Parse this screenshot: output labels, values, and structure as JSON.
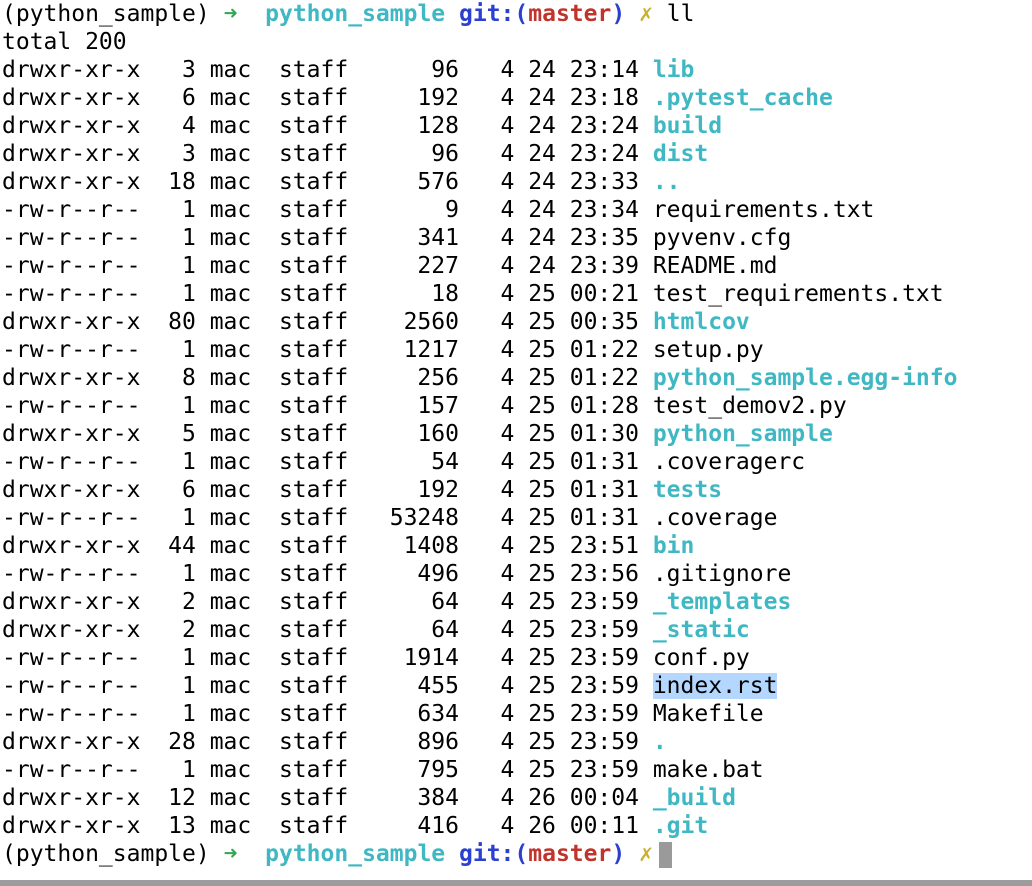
{
  "prompt": {
    "cwd": "(python_sample)",
    "arrow": "➜",
    "repo": "python_sample",
    "git_open": "git:(",
    "branch": "master",
    "git_close": ")",
    "dirty": "✗"
  },
  "command": "ll",
  "total": "total 200",
  "entries": [
    {
      "perm": "drwxr-xr-x",
      "links": "3",
      "owner": "mac",
      "group": "staff",
      "size": "96",
      "month": "4",
      "day": "24",
      "time": "23:14",
      "name": "lib",
      "type": "dir"
    },
    {
      "perm": "drwxr-xr-x",
      "links": "6",
      "owner": "mac",
      "group": "staff",
      "size": "192",
      "month": "4",
      "day": "24",
      "time": "23:18",
      "name": ".pytest_cache",
      "type": "dir"
    },
    {
      "perm": "drwxr-xr-x",
      "links": "4",
      "owner": "mac",
      "group": "staff",
      "size": "128",
      "month": "4",
      "day": "24",
      "time": "23:24",
      "name": "build",
      "type": "dir"
    },
    {
      "perm": "drwxr-xr-x",
      "links": "3",
      "owner": "mac",
      "group": "staff",
      "size": "96",
      "month": "4",
      "day": "24",
      "time": "23:24",
      "name": "dist",
      "type": "dir"
    },
    {
      "perm": "drwxr-xr-x",
      "links": "18",
      "owner": "mac",
      "group": "staff",
      "size": "576",
      "month": "4",
      "day": "24",
      "time": "23:33",
      "name": "..",
      "type": "dir"
    },
    {
      "perm": "-rw-r--r--",
      "links": "1",
      "owner": "mac",
      "group": "staff",
      "size": "9",
      "month": "4",
      "day": "24",
      "time": "23:34",
      "name": "requirements.txt",
      "type": "file"
    },
    {
      "perm": "-rw-r--r--",
      "links": "1",
      "owner": "mac",
      "group": "staff",
      "size": "341",
      "month": "4",
      "day": "24",
      "time": "23:35",
      "name": "pyvenv.cfg",
      "type": "file"
    },
    {
      "perm": "-rw-r--r--",
      "links": "1",
      "owner": "mac",
      "group": "staff",
      "size": "227",
      "month": "4",
      "day": "24",
      "time": "23:39",
      "name": "README.md",
      "type": "file"
    },
    {
      "perm": "-rw-r--r--",
      "links": "1",
      "owner": "mac",
      "group": "staff",
      "size": "18",
      "month": "4",
      "day": "25",
      "time": "00:21",
      "name": "test_requirements.txt",
      "type": "file"
    },
    {
      "perm": "drwxr-xr-x",
      "links": "80",
      "owner": "mac",
      "group": "staff",
      "size": "2560",
      "month": "4",
      "day": "25",
      "time": "00:35",
      "name": "htmlcov",
      "type": "dir"
    },
    {
      "perm": "-rw-r--r--",
      "links": "1",
      "owner": "mac",
      "group": "staff",
      "size": "1217",
      "month": "4",
      "day": "25",
      "time": "01:22",
      "name": "setup.py",
      "type": "file"
    },
    {
      "perm": "drwxr-xr-x",
      "links": "8",
      "owner": "mac",
      "group": "staff",
      "size": "256",
      "month": "4",
      "day": "25",
      "time": "01:22",
      "name": "python_sample.egg-info",
      "type": "dir"
    },
    {
      "perm": "-rw-r--r--",
      "links": "1",
      "owner": "mac",
      "group": "staff",
      "size": "157",
      "month": "4",
      "day": "25",
      "time": "01:28",
      "name": "test_demov2.py",
      "type": "file"
    },
    {
      "perm": "drwxr-xr-x",
      "links": "5",
      "owner": "mac",
      "group": "staff",
      "size": "160",
      "month": "4",
      "day": "25",
      "time": "01:30",
      "name": "python_sample",
      "type": "dir"
    },
    {
      "perm": "-rw-r--r--",
      "links": "1",
      "owner": "mac",
      "group": "staff",
      "size": "54",
      "month": "4",
      "day": "25",
      "time": "01:31",
      "name": ".coveragerc",
      "type": "file"
    },
    {
      "perm": "drwxr-xr-x",
      "links": "6",
      "owner": "mac",
      "group": "staff",
      "size": "192",
      "month": "4",
      "day": "25",
      "time": "01:31",
      "name": "tests",
      "type": "dir"
    },
    {
      "perm": "-rw-r--r--",
      "links": "1",
      "owner": "mac",
      "group": "staff",
      "size": "53248",
      "month": "4",
      "day": "25",
      "time": "01:31",
      "name": ".coverage",
      "type": "file"
    },
    {
      "perm": "drwxr-xr-x",
      "links": "44",
      "owner": "mac",
      "group": "staff",
      "size": "1408",
      "month": "4",
      "day": "25",
      "time": "23:51",
      "name": "bin",
      "type": "dir"
    },
    {
      "perm": "-rw-r--r--",
      "links": "1",
      "owner": "mac",
      "group": "staff",
      "size": "496",
      "month": "4",
      "day": "25",
      "time": "23:56",
      "name": ".gitignore",
      "type": "file"
    },
    {
      "perm": "drwxr-xr-x",
      "links": "2",
      "owner": "mac",
      "group": "staff",
      "size": "64",
      "month": "4",
      "day": "25",
      "time": "23:59",
      "name": "_templates",
      "type": "dir"
    },
    {
      "perm": "drwxr-xr-x",
      "links": "2",
      "owner": "mac",
      "group": "staff",
      "size": "64",
      "month": "4",
      "day": "25",
      "time": "23:59",
      "name": "_static",
      "type": "dir"
    },
    {
      "perm": "-rw-r--r--",
      "links": "1",
      "owner": "mac",
      "group": "staff",
      "size": "1914",
      "month": "4",
      "day": "25",
      "time": "23:59",
      "name": "conf.py",
      "type": "file"
    },
    {
      "perm": "-rw-r--r--",
      "links": "1",
      "owner": "mac",
      "group": "staff",
      "size": "455",
      "month": "4",
      "day": "25",
      "time": "23:59",
      "name": "index.rst",
      "type": "file",
      "selected": true
    },
    {
      "perm": "-rw-r--r--",
      "links": "1",
      "owner": "mac",
      "group": "staff",
      "size": "634",
      "month": "4",
      "day": "25",
      "time": "23:59",
      "name": "Makefile",
      "type": "file"
    },
    {
      "perm": "drwxr-xr-x",
      "links": "28",
      "owner": "mac",
      "group": "staff",
      "size": "896",
      "month": "4",
      "day": "25",
      "time": "23:59",
      "name": ".",
      "type": "dir"
    },
    {
      "perm": "-rw-r--r--",
      "links": "1",
      "owner": "mac",
      "group": "staff",
      "size": "795",
      "month": "4",
      "day": "25",
      "time": "23:59",
      "name": "make.bat",
      "type": "file"
    },
    {
      "perm": "drwxr-xr-x",
      "links": "12",
      "owner": "mac",
      "group": "staff",
      "size": "384",
      "month": "4",
      "day": "26",
      "time": "00:04",
      "name": "_build",
      "type": "dir"
    },
    {
      "perm": "drwxr-xr-x",
      "links": "13",
      "owner": "mac",
      "group": "staff",
      "size": "416",
      "month": "4",
      "day": "26",
      "time": "00:11",
      "name": ".git",
      "type": "dir"
    }
  ],
  "colors": {
    "directory": "#3fb8c4",
    "prompt_arrow": "#2da94f",
    "git_label": "#2b3fd1",
    "branch": "#c0342c",
    "dirty_mark": "#c9b02e",
    "selection": "#b3d7ff"
  }
}
